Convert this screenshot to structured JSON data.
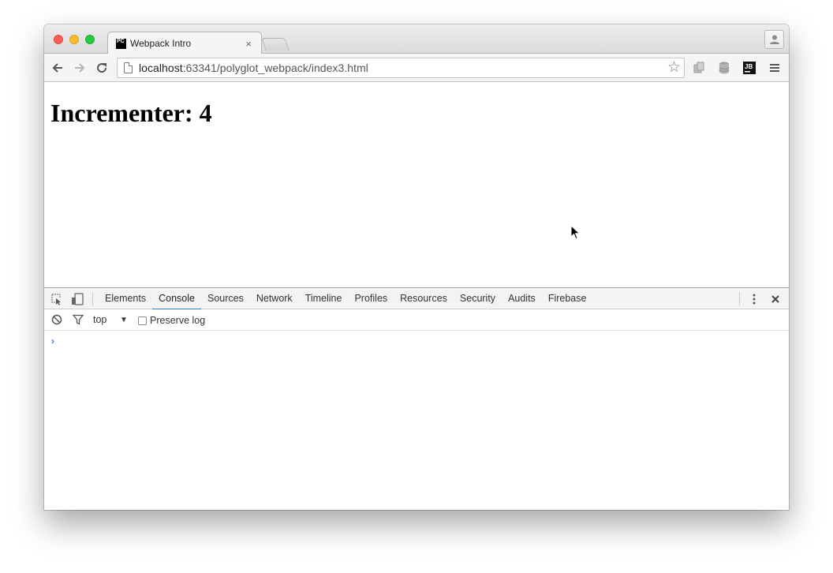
{
  "browser": {
    "tab": {
      "favicon_text": "PC",
      "title": "Webpack Intro",
      "close_glyph": "×"
    },
    "address": {
      "host": "localhost",
      "rest": ":63341/polyglot_webpack/index3.html"
    },
    "icons": {
      "back": "back-arrow-icon",
      "forward": "forward-arrow-icon",
      "reload": "reload-icon",
      "bookmark": "star-icon",
      "extensions": [
        "puzzle-extension-icon",
        "database-icon",
        "jetbrains-icon"
      ],
      "menu": "hamburger-menu-icon",
      "profile": "profile-icon"
    },
    "jb_badge": "JB"
  },
  "page": {
    "heading": "Incrementer: 4"
  },
  "devtools": {
    "tabs": [
      {
        "label": "Elements",
        "active": false
      },
      {
        "label": "Console",
        "active": true
      },
      {
        "label": "Sources",
        "active": false
      },
      {
        "label": "Network",
        "active": false
      },
      {
        "label": "Timeline",
        "active": false
      },
      {
        "label": "Profiles",
        "active": false
      },
      {
        "label": "Resources",
        "active": false
      },
      {
        "label": "Security",
        "active": false
      },
      {
        "label": "Audits",
        "active": false
      },
      {
        "label": "Firebase",
        "active": false
      }
    ],
    "console": {
      "context": "top",
      "context_arrow": "▼",
      "preserve_log_label": "Preserve log",
      "preserve_log_checked": false,
      "prompt": "›"
    },
    "accent": "#3879d9"
  }
}
